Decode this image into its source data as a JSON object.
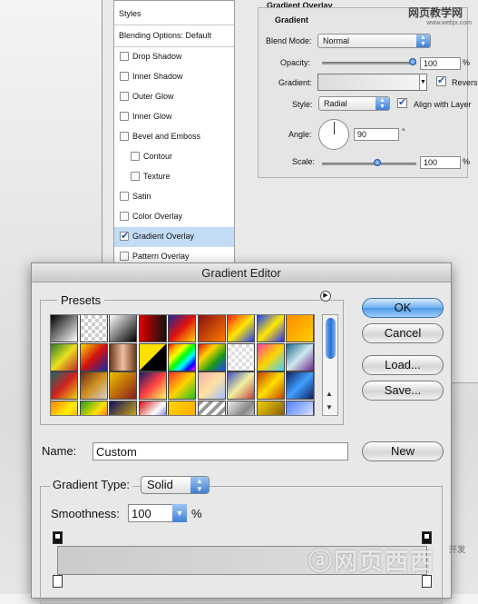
{
  "layer_style": {
    "styles_header": "Styles",
    "blending_options": "Blending Options: Default",
    "items": [
      {
        "label": "Drop Shadow",
        "checked": false,
        "sub": false
      },
      {
        "label": "Inner Shadow",
        "checked": false,
        "sub": false
      },
      {
        "label": "Outer Glow",
        "checked": false,
        "sub": false
      },
      {
        "label": "Inner Glow",
        "checked": false,
        "sub": false
      },
      {
        "label": "Bevel and Emboss",
        "checked": false,
        "sub": false
      },
      {
        "label": "Contour",
        "checked": false,
        "sub": true
      },
      {
        "label": "Texture",
        "checked": false,
        "sub": true
      },
      {
        "label": "Satin",
        "checked": false,
        "sub": false
      },
      {
        "label": "Color Overlay",
        "checked": false,
        "sub": false
      },
      {
        "label": "Gradient Overlay",
        "checked": true,
        "sub": false,
        "active": true
      },
      {
        "label": "Pattern Overlay",
        "checked": false,
        "sub": false
      }
    ],
    "group_title": "Gradient Overlay",
    "subgroup_title": "Gradient",
    "blend_mode_label": "Blend Mode:",
    "blend_mode_value": "Normal",
    "opacity_label": "Opacity:",
    "opacity_value": "100",
    "opacity_level": 1.0,
    "percent": "%",
    "gradient_label": "Gradient:",
    "reverse_label": "Revers",
    "reverse_checked": true,
    "style_label": "Style:",
    "style_value": "Radial",
    "align_label": "Align with Layer",
    "align_checked": true,
    "angle_label": "Angle:",
    "angle_value": "90",
    "degree": "°",
    "scale_label": "Scale:",
    "scale_value": "100",
    "scale_level": 0.5
  },
  "watermark_top": {
    "title": "网页教学网",
    "url": "www.webjx.com"
  },
  "gradient_editor": {
    "title": "Gradient Editor",
    "presets_label": "Presets",
    "ok_label": "OK",
    "cancel_label": "Cancel",
    "load_label": "Load...",
    "save_label": "Save...",
    "name_label": "Name:",
    "name_value": "Custom",
    "new_label": "New",
    "gradient_type_label": "Gradient Type:",
    "gradient_type_value": "Solid",
    "smoothness_label": "Smoothness:",
    "smoothness_value": "100",
    "percent": "%"
  },
  "watermark_bottom": {
    "text": "ⓐ网页西西",
    "small": "开发"
  },
  "colors": {
    "accent": "#4d99e6",
    "selection": "#c3dcf6"
  }
}
